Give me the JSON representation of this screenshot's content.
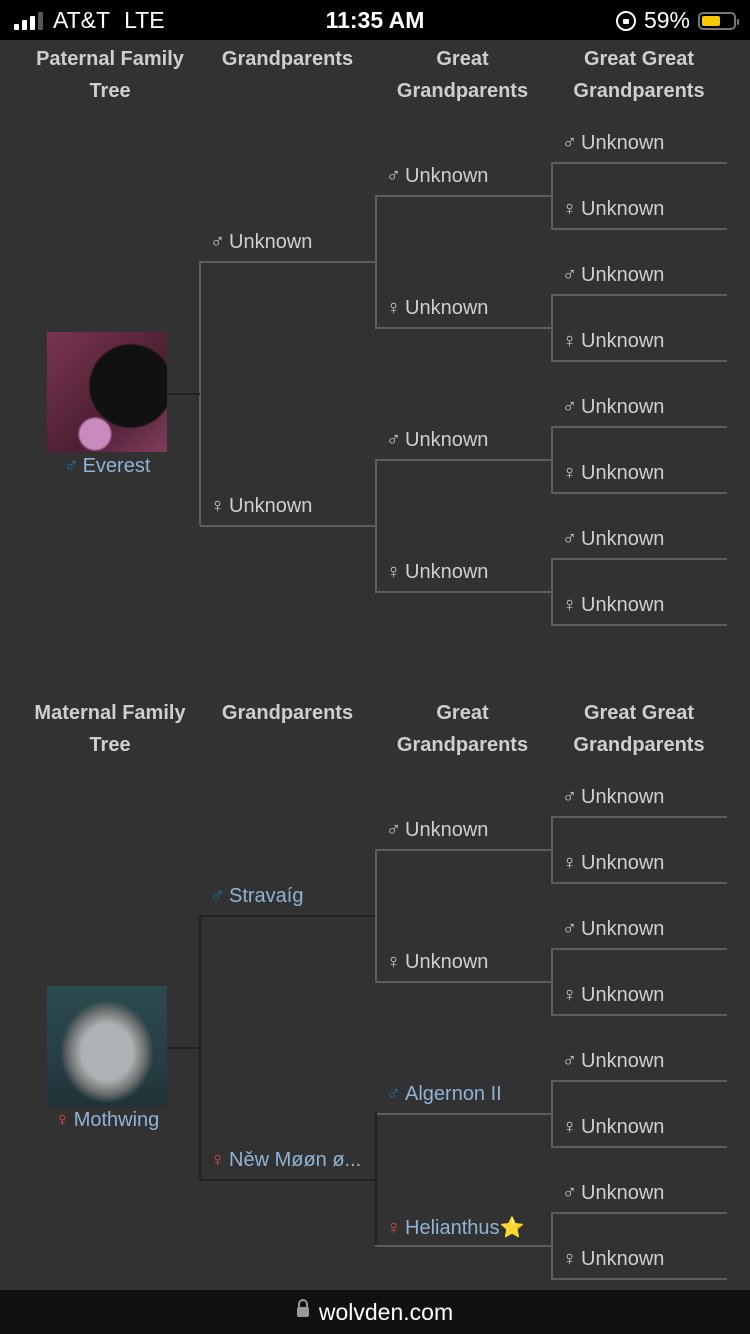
{
  "status_bar": {
    "carrier": "AT&T",
    "network": "LTE",
    "time": "11:35 AM",
    "battery_percent": "59%",
    "battery_level": 0.59
  },
  "url_bar": {
    "domain": "wolvden.com"
  },
  "colors": {
    "male_known": "#1a74b0",
    "female_known": "#d64b45",
    "known_name": "#8fb3d4",
    "unknown_text": "#cfcfcf",
    "background": "#323232"
  },
  "paternal": {
    "headers": {
      "tree": "Paternal Family Tree",
      "grandparents": "Grandparents",
      "great": "Great Grandparents",
      "great_great": "Great Great Grandparents"
    },
    "self": {
      "name": "Everest",
      "sex": "male",
      "symbol": "♂"
    },
    "grandparents": [
      {
        "name": "Unknown",
        "symbol": "♂"
      },
      {
        "name": "Unknown",
        "symbol": "♀"
      }
    ],
    "great": [
      {
        "name": "Unknown",
        "symbol": "♂"
      },
      {
        "name": "Unknown",
        "symbol": "♀"
      },
      {
        "name": "Unknown",
        "symbol": "♂"
      },
      {
        "name": "Unknown",
        "symbol": "♀"
      }
    ],
    "great_great": [
      {
        "name": "Unknown",
        "symbol": "♂"
      },
      {
        "name": "Unknown",
        "symbol": "♀"
      },
      {
        "name": "Unknown",
        "symbol": "♂"
      },
      {
        "name": "Unknown",
        "symbol": "♀"
      },
      {
        "name": "Unknown",
        "symbol": "♂"
      },
      {
        "name": "Unknown",
        "symbol": "♀"
      },
      {
        "name": "Unknown",
        "symbol": "♂"
      },
      {
        "name": "Unknown",
        "symbol": "♀"
      }
    ]
  },
  "maternal": {
    "headers": {
      "tree": "Maternal Family Tree",
      "grandparents": "Grandparents",
      "great": "Great Grandparents",
      "great_great": "Great Great Grandparents"
    },
    "self": {
      "name": "Mothwing",
      "sex": "female",
      "symbol": "♀"
    },
    "grandparents": [
      {
        "name": "Stravaíg",
        "symbol": "♂"
      },
      {
        "name": "Něw Møøn ø...",
        "symbol": "♀"
      }
    ],
    "great": [
      {
        "name": "Unknown",
        "symbol": "♂"
      },
      {
        "name": "Unknown",
        "symbol": "♀"
      },
      {
        "name": "Algernon II",
        "symbol": "♂"
      },
      {
        "name": "Helianthus",
        "symbol": "♀",
        "badge": "⭐"
      }
    ],
    "great_great": [
      {
        "name": "Unknown",
        "symbol": "♂"
      },
      {
        "name": "Unknown",
        "symbol": "♀"
      },
      {
        "name": "Unknown",
        "symbol": "♂"
      },
      {
        "name": "Unknown",
        "symbol": "♀"
      },
      {
        "name": "Unknown",
        "symbol": "♂"
      },
      {
        "name": "Unknown",
        "symbol": "♀"
      },
      {
        "name": "Unknown",
        "symbol": "♂"
      },
      {
        "name": "Unknown",
        "symbol": "♀"
      }
    ]
  }
}
